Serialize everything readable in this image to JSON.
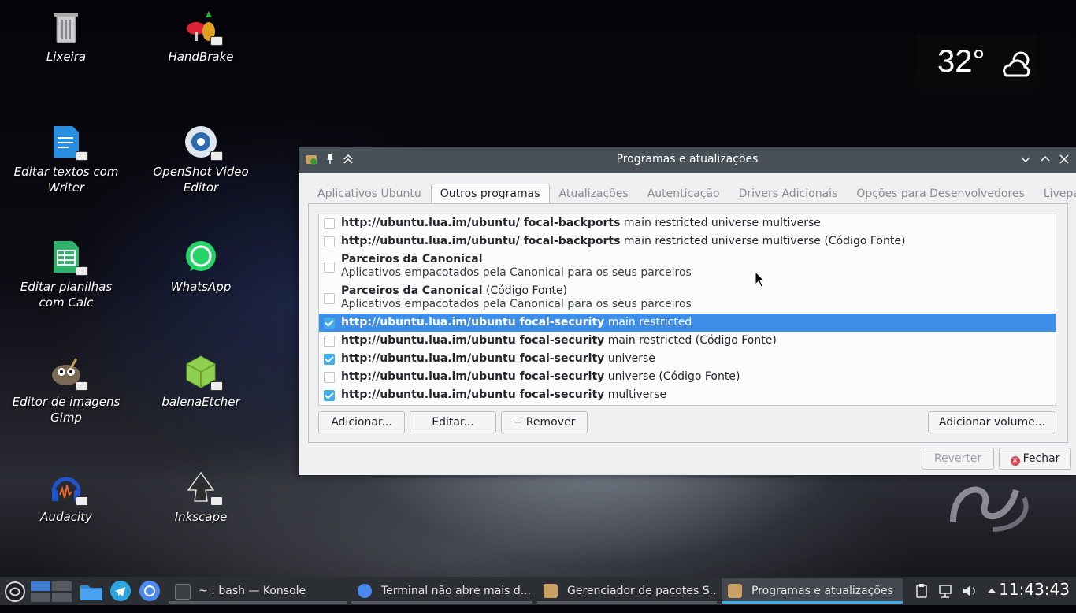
{
  "desktop": {
    "icons": [
      {
        "label": "Lixeira",
        "icon": "trash-icon"
      },
      {
        "label": "HandBrake",
        "icon": "handbrake-icon"
      },
      {
        "label": "Editar textos com Writer",
        "icon": "writer-icon"
      },
      {
        "label": "OpenShot Video Editor",
        "icon": "openshot-icon"
      },
      {
        "label": "Editar planilhas com Calc",
        "icon": "calc-icon"
      },
      {
        "label": "WhatsApp",
        "icon": "whatsapp-icon"
      },
      {
        "label": "Editor de imagens Gimp",
        "icon": "gimp-icon"
      },
      {
        "label": "balenaEtcher",
        "icon": "balenaetcher-icon"
      },
      {
        "label": "Audacity",
        "icon": "audacity-icon"
      },
      {
        "label": "Inkscape",
        "icon": "inkscape-icon"
      }
    ]
  },
  "weather": {
    "temperature": "32°",
    "icon": "partly-cloudy-icon"
  },
  "window": {
    "title": "Programas e atualizações",
    "tabs": [
      {
        "label": "Aplicativos Ubuntu",
        "active": false
      },
      {
        "label": "Outros programas",
        "active": true
      },
      {
        "label": "Atualizações",
        "active": false
      },
      {
        "label": "Autenticação",
        "active": false
      },
      {
        "label": "Drivers Adicionais",
        "active": false
      },
      {
        "label": "Opções para Desenvolvedores",
        "active": false
      },
      {
        "label": "Livepatch",
        "active": false
      }
    ],
    "sources": [
      {
        "bold": "http://ubuntu.lua.im/ubuntu/ focal-backports",
        "rest": " main restricted universe multiverse",
        "checked": false
      },
      {
        "bold": "http://ubuntu.lua.im/ubuntu/ focal-backports",
        "rest": " main restricted universe multiverse (Código Fonte)",
        "checked": false
      },
      {
        "bold": "Parceiros da Canonical",
        "rest": "",
        "sub": "Aplicativos empacotados pela Canonical para os seus parceiros",
        "checked": false
      },
      {
        "bold": "Parceiros da Canonical",
        "rest": " (Código Fonte)",
        "sub": "Aplicativos empacotados pela Canonical para os seus parceiros",
        "checked": false
      },
      {
        "bold": "http://ubuntu.lua.im/ubuntu focal-security",
        "rest": " main restricted",
        "checked": true,
        "selected": true
      },
      {
        "bold": "http://ubuntu.lua.im/ubuntu focal-security",
        "rest": " main restricted (Código Fonte)",
        "checked": false
      },
      {
        "bold": "http://ubuntu.lua.im/ubuntu focal-security",
        "rest": " universe",
        "checked": true
      },
      {
        "bold": "http://ubuntu.lua.im/ubuntu focal-security",
        "rest": " universe (Código Fonte)",
        "checked": false
      },
      {
        "bold": "http://ubuntu.lua.im/ubuntu focal-security",
        "rest": " multiverse",
        "checked": true
      }
    ],
    "buttons": {
      "add": "Adicionar...",
      "edit": "Editar...",
      "remove": "Remover",
      "add_volume": "Adicionar volume...",
      "revert": "Reverter",
      "close": "Fechar"
    }
  },
  "taskbar": {
    "tasks": [
      {
        "label": "~ : bash — Konsole",
        "icon": "konsole-icon",
        "active": false
      },
      {
        "label": "Terminal não abre mais d...",
        "icon": "chromium-icon",
        "active": false
      },
      {
        "label": "Gerenciador de pacotes S...",
        "icon": "package-manager-icon",
        "active": false
      },
      {
        "label": "Programas e atualizações",
        "icon": "software-properties-icon",
        "active": true
      }
    ],
    "clock": "11:43:43"
  },
  "colors": {
    "selection": "#3d8ee9",
    "accent": "#3daee9",
    "titlebar": "#475057",
    "taskbar": "#2b2f33"
  }
}
